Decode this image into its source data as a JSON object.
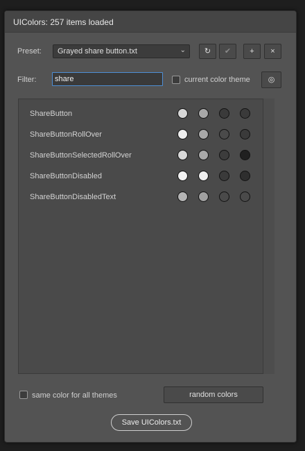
{
  "window": {
    "title": "UIColors: 257 items loaded"
  },
  "preset": {
    "label": "Preset:",
    "value": "Grayed share button.txt",
    "buttons": [
      {
        "name": "refresh-icon",
        "glyph": "↻",
        "enabled": true
      },
      {
        "name": "checkmark-icon",
        "glyph": "✔",
        "enabled": false
      },
      {
        "name": "plus-icon",
        "glyph": "+",
        "enabled": true
      },
      {
        "name": "close-icon",
        "glyph": "×",
        "enabled": true
      }
    ]
  },
  "filter": {
    "label": "Filter:",
    "value": "share",
    "current_theme_label": "current color theme",
    "current_theme_checked": false,
    "theme_button_icon": "target-icon"
  },
  "items": [
    {
      "name": "ShareButton",
      "colors": [
        "#d8d8d8",
        "#a8a8a8",
        "#3a3a3a",
        "#3a3a3a"
      ]
    },
    {
      "name": "ShareButtonRollOver",
      "colors": [
        "#eeeeee",
        "#a8a8a8",
        "#4a4a4a",
        "#3a3a3a"
      ]
    },
    {
      "name": "ShareButtonSelectedRollOver",
      "colors": [
        "#d8d8d8",
        "#a8a8a8",
        "#3c3c3c",
        "#202020"
      ]
    },
    {
      "name": "ShareButtonDisabled",
      "colors": [
        "#f2f2f2",
        "#eeeeee",
        "#3a3a3a",
        "#2e2e2e"
      ]
    },
    {
      "name": "ShareButtonDisabledText",
      "colors": [
        "#b4b4b4",
        "#a0a0a0",
        "#4a4a4a",
        "#4a4a4a"
      ]
    }
  ],
  "footer": {
    "same_color_label": "same color for all themes",
    "same_color_checked": false,
    "random_label": "random colors",
    "save_label": "Save UIColors.txt"
  }
}
